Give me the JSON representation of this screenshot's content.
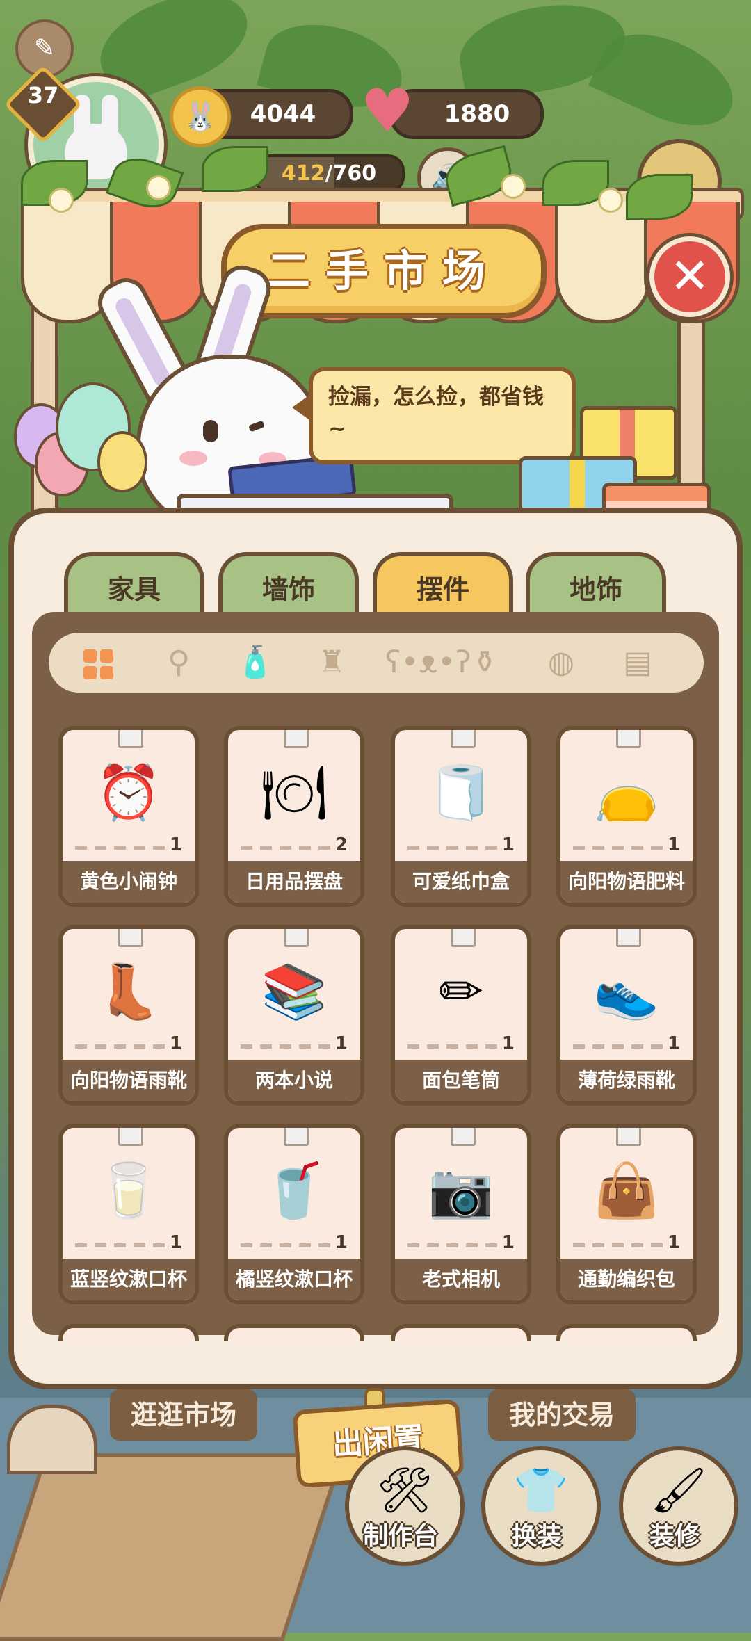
{
  "hud": {
    "level": "37",
    "coins": "4044",
    "hearts": "1880",
    "exp_current": "412",
    "exp_total": "/760",
    "exp_fraction": 0.54
  },
  "market": {
    "title": "二手市场",
    "speech": "捡漏，怎么捡，都省钱~",
    "close_icon": "close-icon"
  },
  "tabs": [
    {
      "label": "家具",
      "active": false
    },
    {
      "label": "墙饰",
      "active": false
    },
    {
      "label": "摆件",
      "active": true
    },
    {
      "label": "地饰",
      "active": false
    }
  ],
  "filters": [
    "grid-icon",
    "spatula-icon",
    "bottles-icon",
    "lamp-icon",
    "teddy-bear-icon",
    "vase-icon",
    "ball-icon",
    "tissue-box-icon"
  ],
  "items": [
    {
      "name": "黄色小闹钟",
      "count": "1",
      "icon": "⏰"
    },
    {
      "name": "日用品摆盘",
      "count": "2",
      "icon": "🍽"
    },
    {
      "name": "可爱纸巾盒",
      "count": "1",
      "icon": "🧻"
    },
    {
      "name": "向阳物语肥料",
      "count": "1",
      "icon": "👝"
    },
    {
      "name": "向阳物语雨靴",
      "count": "1",
      "icon": "👢"
    },
    {
      "name": "两本小说",
      "count": "1",
      "icon": "📚"
    },
    {
      "name": "面包笔筒",
      "count": "1",
      "icon": "✏"
    },
    {
      "name": "薄荷绿雨靴",
      "count": "1",
      "icon": "👟"
    },
    {
      "name": "蓝竖纹漱口杯",
      "count": "1",
      "icon": "🥛"
    },
    {
      "name": "橘竖纹漱口杯",
      "count": "1",
      "icon": "🥤"
    },
    {
      "name": "老式相机",
      "count": "1",
      "icon": "📷"
    },
    {
      "name": "通勤编织包",
      "count": "1",
      "icon": "👜"
    }
  ],
  "bottom": {
    "browse": "逛逛市场",
    "sell": "出闲置",
    "my_trades": "我的交易"
  },
  "nav": [
    {
      "label": "制作台",
      "icon": "workbench-icon"
    },
    {
      "label": "换装",
      "icon": "outfit-icon"
    },
    {
      "label": "装修",
      "icon": "paint-roller-icon"
    }
  ],
  "colors": {
    "panel": "#f6ebdc",
    "border": "#6b4f34",
    "tab_active": "#f6c65f",
    "tab_inactive": "#a8c184",
    "inner": "#7b5f46"
  }
}
